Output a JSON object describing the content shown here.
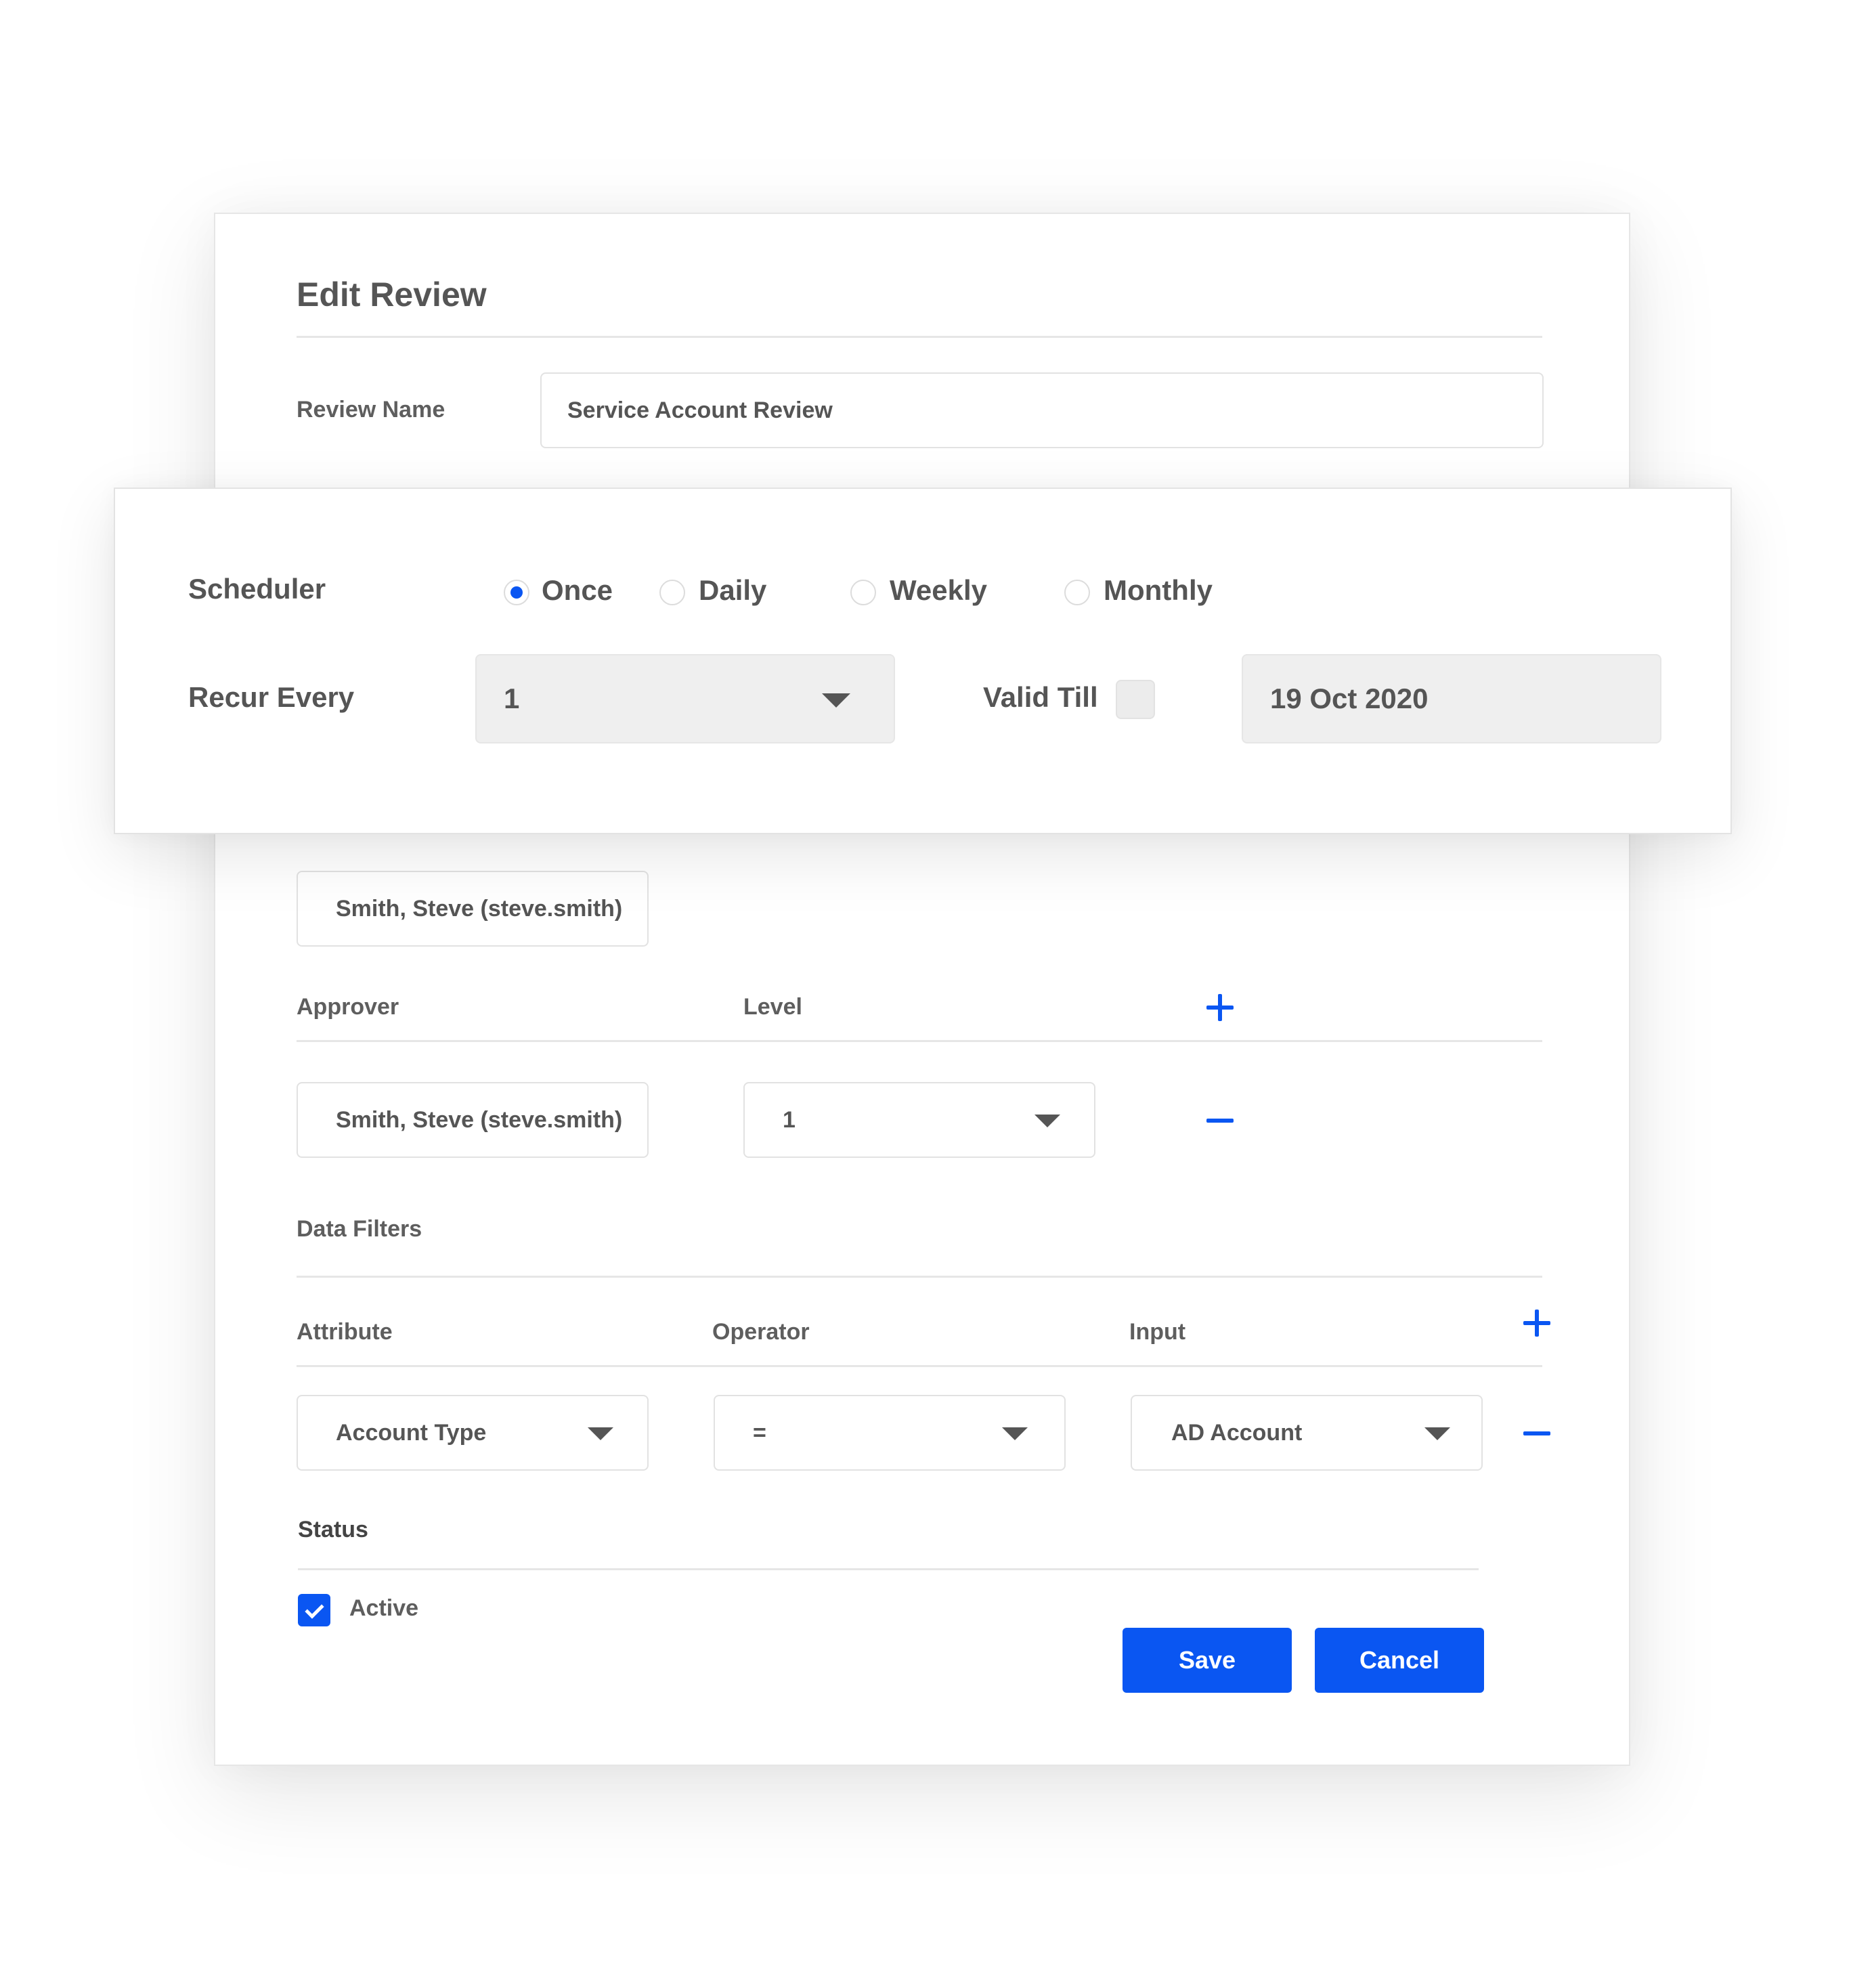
{
  "form": {
    "title": "Edit Review",
    "review_name_label": "Review Name",
    "review_name_value": "Service Account Review"
  },
  "scheduler": {
    "label": "Scheduler",
    "options": [
      {
        "label": "Once",
        "selected": true
      },
      {
        "label": "Daily",
        "selected": false
      },
      {
        "label": "Weekly",
        "selected": false
      },
      {
        "label": "Monthly",
        "selected": false
      }
    ],
    "recur_label": "Recur Every",
    "recur_value": "1",
    "valid_till_label": "Valid Till",
    "valid_till_checked": false,
    "valid_till_date": "19 Oct 2020"
  },
  "owner": {
    "value": "Smith, Steve (steve.smith)"
  },
  "approvers": {
    "approver_header": "Approver",
    "level_header": "Level",
    "rows": [
      {
        "approver": "Smith, Steve (steve.smith)",
        "level": "1"
      }
    ]
  },
  "data_filters": {
    "title": "Data Filters",
    "attribute_header": "Attribute",
    "operator_header": "Operator",
    "input_header": "Input",
    "rows": [
      {
        "attribute": "Account Type",
        "operator": "=",
        "input": "AD Account"
      }
    ]
  },
  "status": {
    "title": "Status",
    "active_label": "Active",
    "active_checked": true
  },
  "actions": {
    "save_label": "Save",
    "cancel_label": "Cancel"
  },
  "colors": {
    "accent": "#0a56f2",
    "text": "#555555",
    "border": "#e2e2e2",
    "field_gray": "#efefef"
  },
  "icons": [
    "dropdown-caret-icon",
    "plus-icon",
    "minus-icon",
    "checkmark-icon"
  ]
}
